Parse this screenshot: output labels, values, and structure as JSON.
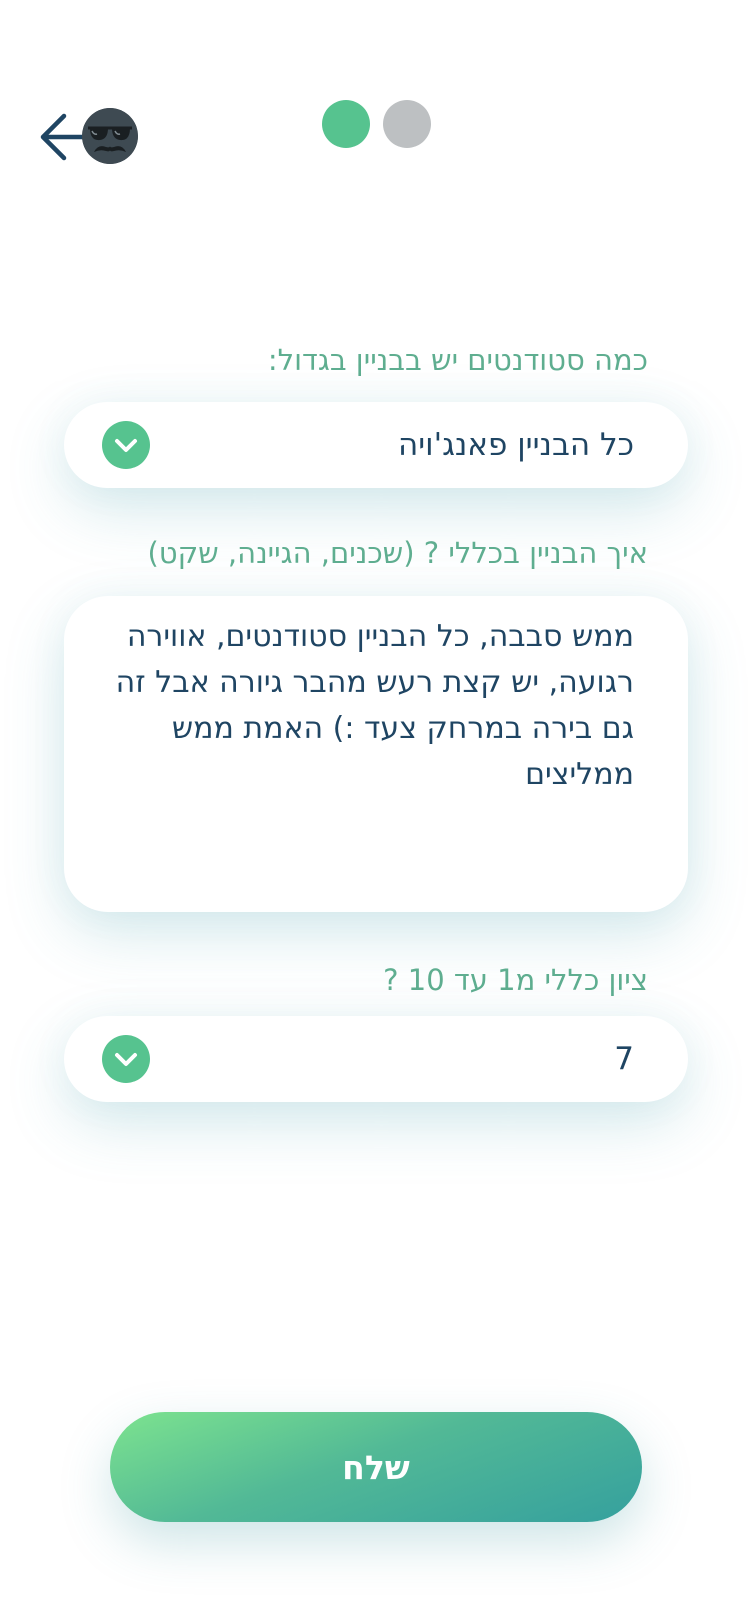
{
  "header": {
    "back_icon": "arrow-left-icon",
    "avatar_icon": "mustache-glasses-avatar-icon",
    "steps": [
      {
        "state": "active",
        "color": "#56c38f"
      },
      {
        "state": "inactive",
        "color": "#bdc0c2"
      }
    ]
  },
  "form": {
    "students_question": {
      "label": "כמה סטודנטים יש בבניין בגדול:",
      "value": "כל הבניין פאנג'ויה",
      "icon": "chevron-down-icon"
    },
    "building_question": {
      "label": "איך הבניין בכללי ? (שכנים, הגיינה, שקט)",
      "value": "ממש סבבה, כל הבניין סטודנטים, אווירה רגועה, יש קצת רעש מהבר גיורה אבל זה גם בירה במרחק צעד :) האמת ממש ממליצים"
    },
    "rating_question": {
      "label": "ציון כללי מ1 עד 10 ?",
      "value": "7",
      "icon": "chevron-down-icon"
    }
  },
  "submit": {
    "label": "שלח"
  },
  "colors": {
    "accent": "#56c38f",
    "label": "#5fae90",
    "text": "#1f4563",
    "inactive": "#bdc0c2"
  }
}
